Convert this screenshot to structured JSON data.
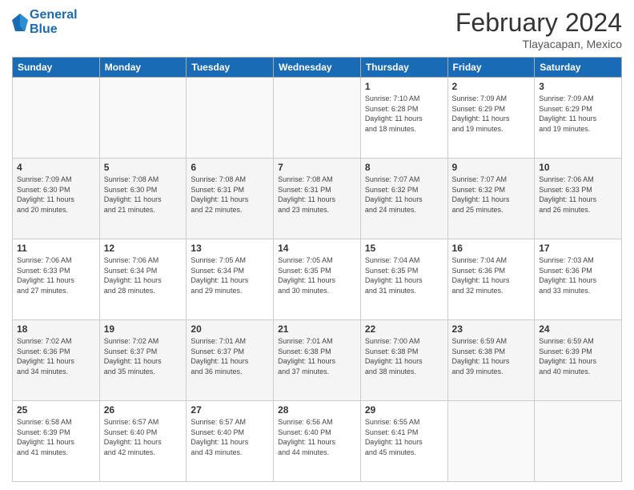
{
  "logo": {
    "line1": "General",
    "line2": "Blue"
  },
  "title": "February 2024",
  "subtitle": "Tlayacapan, Mexico",
  "days_of_week": [
    "Sunday",
    "Monday",
    "Tuesday",
    "Wednesday",
    "Thursday",
    "Friday",
    "Saturday"
  ],
  "weeks": [
    [
      {
        "day": "",
        "info": ""
      },
      {
        "day": "",
        "info": ""
      },
      {
        "day": "",
        "info": ""
      },
      {
        "day": "",
        "info": ""
      },
      {
        "day": "1",
        "info": "Sunrise: 7:10 AM\nSunset: 6:28 PM\nDaylight: 11 hours\nand 18 minutes."
      },
      {
        "day": "2",
        "info": "Sunrise: 7:09 AM\nSunset: 6:29 PM\nDaylight: 11 hours\nand 19 minutes."
      },
      {
        "day": "3",
        "info": "Sunrise: 7:09 AM\nSunset: 6:29 PM\nDaylight: 11 hours\nand 19 minutes."
      }
    ],
    [
      {
        "day": "4",
        "info": "Sunrise: 7:09 AM\nSunset: 6:30 PM\nDaylight: 11 hours\nand 20 minutes."
      },
      {
        "day": "5",
        "info": "Sunrise: 7:08 AM\nSunset: 6:30 PM\nDaylight: 11 hours\nand 21 minutes."
      },
      {
        "day": "6",
        "info": "Sunrise: 7:08 AM\nSunset: 6:31 PM\nDaylight: 11 hours\nand 22 minutes."
      },
      {
        "day": "7",
        "info": "Sunrise: 7:08 AM\nSunset: 6:31 PM\nDaylight: 11 hours\nand 23 minutes."
      },
      {
        "day": "8",
        "info": "Sunrise: 7:07 AM\nSunset: 6:32 PM\nDaylight: 11 hours\nand 24 minutes."
      },
      {
        "day": "9",
        "info": "Sunrise: 7:07 AM\nSunset: 6:32 PM\nDaylight: 11 hours\nand 25 minutes."
      },
      {
        "day": "10",
        "info": "Sunrise: 7:06 AM\nSunset: 6:33 PM\nDaylight: 11 hours\nand 26 minutes."
      }
    ],
    [
      {
        "day": "11",
        "info": "Sunrise: 7:06 AM\nSunset: 6:33 PM\nDaylight: 11 hours\nand 27 minutes."
      },
      {
        "day": "12",
        "info": "Sunrise: 7:06 AM\nSunset: 6:34 PM\nDaylight: 11 hours\nand 28 minutes."
      },
      {
        "day": "13",
        "info": "Sunrise: 7:05 AM\nSunset: 6:34 PM\nDaylight: 11 hours\nand 29 minutes."
      },
      {
        "day": "14",
        "info": "Sunrise: 7:05 AM\nSunset: 6:35 PM\nDaylight: 11 hours\nand 30 minutes."
      },
      {
        "day": "15",
        "info": "Sunrise: 7:04 AM\nSunset: 6:35 PM\nDaylight: 11 hours\nand 31 minutes."
      },
      {
        "day": "16",
        "info": "Sunrise: 7:04 AM\nSunset: 6:36 PM\nDaylight: 11 hours\nand 32 minutes."
      },
      {
        "day": "17",
        "info": "Sunrise: 7:03 AM\nSunset: 6:36 PM\nDaylight: 11 hours\nand 33 minutes."
      }
    ],
    [
      {
        "day": "18",
        "info": "Sunrise: 7:02 AM\nSunset: 6:36 PM\nDaylight: 11 hours\nand 34 minutes."
      },
      {
        "day": "19",
        "info": "Sunrise: 7:02 AM\nSunset: 6:37 PM\nDaylight: 11 hours\nand 35 minutes."
      },
      {
        "day": "20",
        "info": "Sunrise: 7:01 AM\nSunset: 6:37 PM\nDaylight: 11 hours\nand 36 minutes."
      },
      {
        "day": "21",
        "info": "Sunrise: 7:01 AM\nSunset: 6:38 PM\nDaylight: 11 hours\nand 37 minutes."
      },
      {
        "day": "22",
        "info": "Sunrise: 7:00 AM\nSunset: 6:38 PM\nDaylight: 11 hours\nand 38 minutes."
      },
      {
        "day": "23",
        "info": "Sunrise: 6:59 AM\nSunset: 6:38 PM\nDaylight: 11 hours\nand 39 minutes."
      },
      {
        "day": "24",
        "info": "Sunrise: 6:59 AM\nSunset: 6:39 PM\nDaylight: 11 hours\nand 40 minutes."
      }
    ],
    [
      {
        "day": "25",
        "info": "Sunrise: 6:58 AM\nSunset: 6:39 PM\nDaylight: 11 hours\nand 41 minutes."
      },
      {
        "day": "26",
        "info": "Sunrise: 6:57 AM\nSunset: 6:40 PM\nDaylight: 11 hours\nand 42 minutes."
      },
      {
        "day": "27",
        "info": "Sunrise: 6:57 AM\nSunset: 6:40 PM\nDaylight: 11 hours\nand 43 minutes."
      },
      {
        "day": "28",
        "info": "Sunrise: 6:56 AM\nSunset: 6:40 PM\nDaylight: 11 hours\nand 44 minutes."
      },
      {
        "day": "29",
        "info": "Sunrise: 6:55 AM\nSunset: 6:41 PM\nDaylight: 11 hours\nand 45 minutes."
      },
      {
        "day": "",
        "info": ""
      },
      {
        "day": "",
        "info": ""
      }
    ]
  ]
}
